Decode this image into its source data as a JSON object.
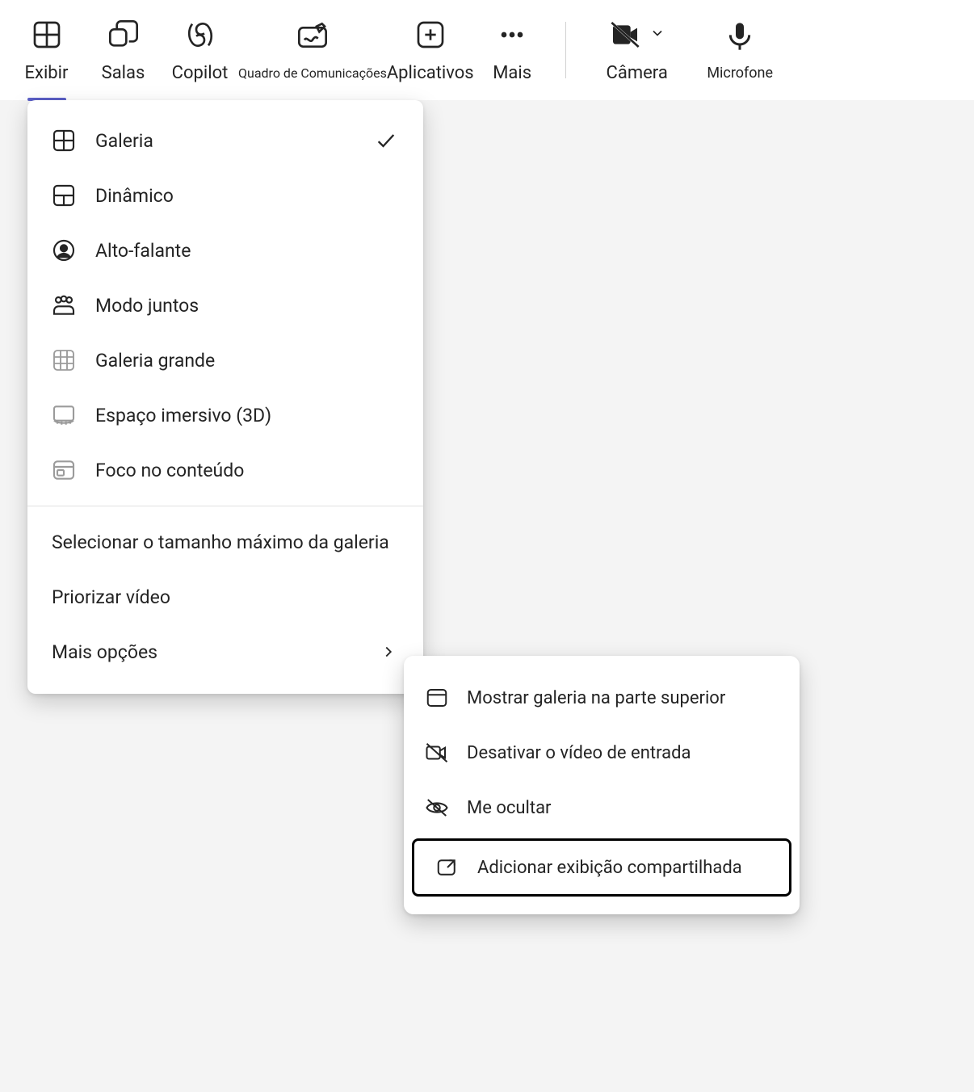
{
  "toolbar": {
    "items": [
      {
        "label": "Exibir"
      },
      {
        "label": "Salas"
      },
      {
        "label": "Copilot"
      },
      {
        "label": "Quadro de Comunicações"
      },
      {
        "label": "Aplicativos"
      },
      {
        "label": "Mais"
      }
    ],
    "camera": "Câmera",
    "microphone": "Microfone"
  },
  "menu": {
    "items": [
      {
        "label": "Galeria"
      },
      {
        "label": "Dinâmico"
      },
      {
        "label": "Alto-falante"
      },
      {
        "label": "Modo juntos"
      },
      {
        "label": "Galeria grande"
      },
      {
        "label": "Espaço imersivo (3D)"
      },
      {
        "label": "Foco no conteúdo"
      }
    ],
    "extra": [
      {
        "label": "Selecionar o tamanho máximo da galeria"
      },
      {
        "label": "Priorizar vídeo"
      },
      {
        "label": "Mais opções"
      }
    ]
  },
  "submenu": {
    "items": [
      {
        "label": "Mostrar galeria na parte superior"
      },
      {
        "label": "Desativar o vídeo de entrada"
      },
      {
        "label": "Me ocultar"
      },
      {
        "label": "Adicionar exibição compartilhada"
      }
    ]
  }
}
